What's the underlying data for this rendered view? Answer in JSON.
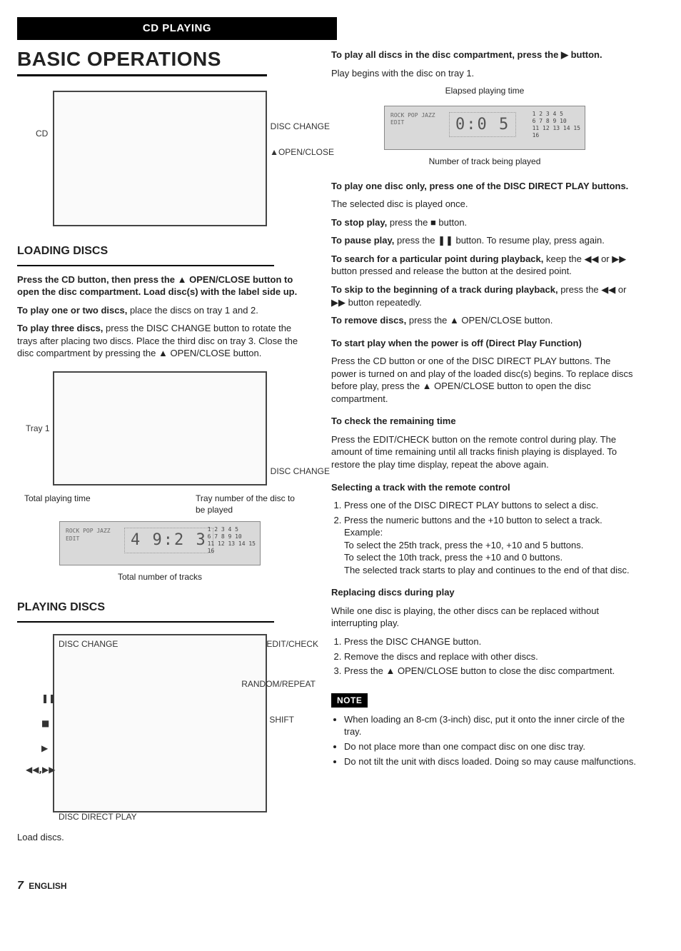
{
  "header_bar": "CD PLAYING",
  "main_title": "BASIC OPERATIONS",
  "fig1": {
    "cd": "CD",
    "disc_change": "DISC CHANGE",
    "open_close": "▲OPEN/CLOSE"
  },
  "loading": {
    "heading": "LOADING DISCS",
    "instr": "Press the CD button, then press the ▲ OPEN/CLOSE button to open the disc compartment. Load disc(s) with the label side up.",
    "one_two_b": "To play one or two discs,",
    "one_two_t": " place the discs on tray 1 and 2.",
    "three_b": "To play three discs,",
    "three_t": " press the DISC CHANGE button to rotate the trays after placing two discs. Place the third disc on tray 3. Close the disc compartment by pressing the ▲ OPEN/CLOSE button."
  },
  "fig2": {
    "tray1": "Tray 1",
    "disc_change": "DISC CHANGE"
  },
  "display1": {
    "total_time_lbl": "Total playing time",
    "tray_lbl": "Tray number of the disc to be played",
    "time": "4 9:2 3",
    "tracks_lbl": "Total number of tracks",
    "small1": "ROCK POP JAZZ",
    "small2": "EDIT",
    "grid": "1 2 3 4 5\n6 7 8 9 10\n11 12 13 14 15\n16"
  },
  "playing": {
    "heading": "PLAYING DISCS",
    "disc_change": "DISC CHANGE",
    "edit_check": "EDIT/CHECK",
    "random": "RANDOM/REPEAT",
    "shift": "SHIFT",
    "disc_direct": "DISC DIRECT PLAY",
    "pause": "❚❚",
    "stop": "■",
    "play": "▶",
    "seek": "◀◀,▶▶",
    "load": "Load discs."
  },
  "right": {
    "play_all_title": "To play all discs in the disc compartment, press the ▶ button.",
    "play_all_text": "Play begins with the disc on tray 1.",
    "elapsed_lbl": "Elapsed playing time",
    "display_time": "0:0 5",
    "num_track_lbl": "Number of track being played",
    "one_disc_title": "To play one disc only, press one of the DISC DIRECT PLAY buttons.",
    "one_disc_text": "The selected disc is played once.",
    "stop_b": "To stop play,",
    "stop_t": " press the ■ button.",
    "pause_b": "To pause play,",
    "pause_t": " press the ❚❚ button. To resume play, press again.",
    "search_b": "To search for a particular point during playback,",
    "search_t": " keep the ◀◀ or ▶▶ button pressed and release the button at the desired point.",
    "skip_b": "To skip to the beginning of a track during playback,",
    "skip_t": " press the ◀◀ or ▶▶ button repeatedly.",
    "remove_b": "To remove discs,",
    "remove_t": " press the ▲ OPEN/CLOSE button.",
    "direct_title": "To start play when the power is off (Direct Play Function)",
    "direct_text": "Press the CD button or one of the DISC DIRECT PLAY buttons. The power is turned on and play of the loaded disc(s) begins. To replace discs before play, press the ▲ OPEN/CLOSE button to open the disc compartment.",
    "check_title": "To check the remaining time",
    "check_text": "Press the EDIT/CHECK button on the remote control during play. The amount of time remaining until all tracks finish playing is displayed. To restore the play time display, repeat the above again.",
    "select_title": "Selecting a track with the remote control",
    "select_1": "Press one of the DISC DIRECT PLAY buttons to select a disc.",
    "select_2": "Press the numeric buttons and the +10 button to select a track.",
    "select_ex_lbl": "Example:",
    "select_ex1": "To select the 25th track, press the +10, +10 and 5 buttons.",
    "select_ex2": "To select the 10th track, press the +10 and 0 buttons.",
    "select_ex3": "The selected track starts to play and continues to the end of that disc.",
    "replace_title": "Replacing discs during play",
    "replace_intro": "While one disc is playing, the other discs can be replaced without interrupting play.",
    "replace_1": "Press the DISC CHANGE button.",
    "replace_2": "Remove the discs and replace with other discs.",
    "replace_3": "Press the ▲ OPEN/CLOSE button to close the disc compartment.",
    "note_label": "NOTE",
    "note_1": "When loading an 8-cm (3-inch) disc, put it onto the inner circle of the tray.",
    "note_2": "Do not place more than one compact disc on one disc tray.",
    "note_3": "Do not tilt the unit with discs loaded. Doing so may cause malfunctions."
  },
  "footer": {
    "page": "7",
    "lang": "ENGLISH"
  }
}
